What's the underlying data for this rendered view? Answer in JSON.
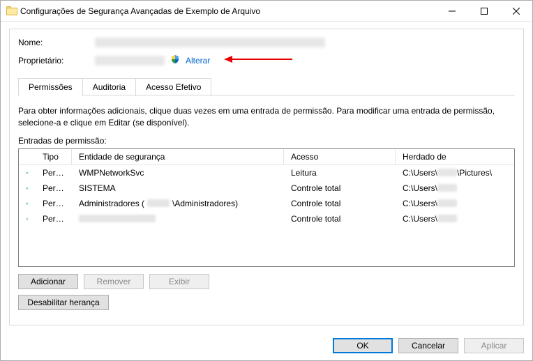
{
  "window": {
    "title": "Configurações de Segurança Avançadas de Exemplo de Arquivo"
  },
  "labels": {
    "name": "Nome:",
    "owner": "Proprietário:",
    "change": "Alterar",
    "entries": "Entradas de permissão:",
    "desc": "Para obter informações adicionais, clique duas vezes em uma entrada de permissão. Para modificar uma entrada de permissão, selecione-a e clique em Editar (se disponível)."
  },
  "tabs": [
    {
      "label": "Permissões",
      "active": true
    },
    {
      "label": "Auditoria",
      "active": false
    },
    {
      "label": "Acesso Efetivo",
      "active": false
    }
  ],
  "columns": {
    "tipo": "Tipo",
    "entidade": "Entidade de segurança",
    "acesso": "Acesso",
    "herdado": "Herdado de"
  },
  "rows": [
    {
      "icon": "group",
      "tipo": "Perm…",
      "entidade_prefix": "WMPNetworkSvc",
      "entidade_blur1": 0,
      "entidade_mid": "",
      "entidade_blur2": 0,
      "entidade_suffix": "",
      "acesso": "Leitura",
      "herd_prefix": "C:\\Users\\",
      "herd_blur": 28,
      "herd_suffix": "\\Pictures\\"
    },
    {
      "icon": "group",
      "tipo": "Perm…",
      "entidade_prefix": "SISTEMA",
      "entidade_blur1": 0,
      "entidade_mid": "",
      "entidade_blur2": 0,
      "entidade_suffix": "",
      "acesso": "Controle total",
      "herd_prefix": "C:\\Users\\",
      "herd_blur": 28,
      "herd_suffix": ""
    },
    {
      "icon": "group",
      "tipo": "Perm…",
      "entidade_prefix": "Administradores (",
      "entidade_blur1": 32,
      "entidade_mid": "",
      "entidade_blur2": 0,
      "entidade_suffix": "\\Administradores)",
      "acesso": "Controle total",
      "herd_prefix": "C:\\Users\\",
      "herd_blur": 28,
      "herd_suffix": ""
    },
    {
      "icon": "person",
      "tipo": "Perm…",
      "entidade_prefix": "",
      "entidade_blur1": 110,
      "entidade_mid": "",
      "entidade_blur2": 0,
      "entidade_suffix": "",
      "acesso": "Controle total",
      "herd_prefix": "C:\\Users\\",
      "herd_blur": 28,
      "herd_suffix": ""
    }
  ],
  "buttons": {
    "add": "Adicionar",
    "remove": "Remover",
    "view": "Exibir",
    "disable_inh": "Desabilitar herança",
    "ok": "OK",
    "cancel": "Cancelar",
    "apply": "Aplicar"
  }
}
